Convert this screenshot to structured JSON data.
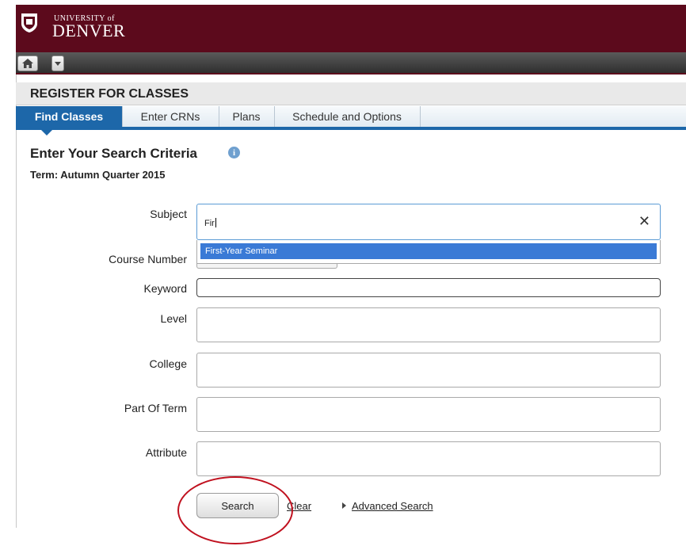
{
  "header": {
    "logo_small": "UNIVERSITY of",
    "logo_big": "DENVER",
    "brand_color": "#5c0a1c"
  },
  "toolbar": {
    "home_icon": "home-icon",
    "menu_icon": "caret-down-icon"
  },
  "page": {
    "title": "REGISTER FOR CLASSES",
    "tabs": [
      {
        "label": "Find Classes",
        "active": true
      },
      {
        "label": "Enter CRNs",
        "active": false
      },
      {
        "label": "Plans",
        "active": false
      },
      {
        "label": "Schedule and Options",
        "active": false
      }
    ]
  },
  "search": {
    "title": "Enter Your Search Criteria",
    "term": "Term: Autumn Quarter 2015",
    "subject_label": "Subject",
    "subject_value": "Fir",
    "subject_clear": "✕",
    "suggestion": "First-Year Seminar",
    "course_number_label": "Course Number",
    "keyword_label": "Keyword",
    "keyword_value": "",
    "level_label": "Level",
    "college_label": "College",
    "part_of_term_label": "Part Of Term",
    "attribute_label": "Attribute",
    "search_button": "Search",
    "clear_link": "Clear",
    "advanced_link": "Advanced Search"
  },
  "colors": {
    "tab_active": "#1d67a9",
    "suggestion_highlight": "#3a7ad6",
    "annotation": "#c0111f"
  }
}
